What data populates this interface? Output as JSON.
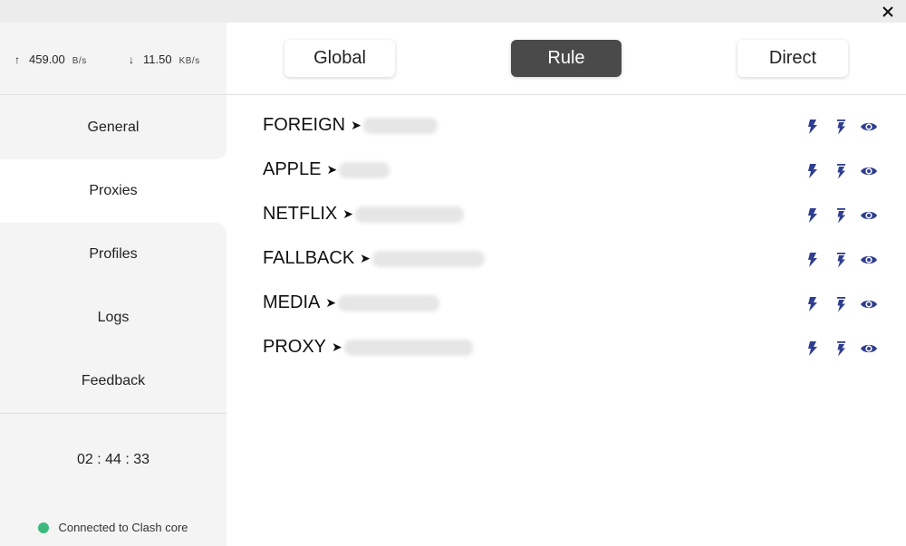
{
  "traffic": {
    "up_arrow": "↑",
    "up_value": "459.00",
    "up_unit": "B/s",
    "down_arrow": "↓",
    "down_value": "11.50",
    "down_unit": "KB/s"
  },
  "nav": {
    "items": [
      {
        "label": "General"
      },
      {
        "label": "Proxies"
      },
      {
        "label": "Profiles"
      },
      {
        "label": "Logs"
      },
      {
        "label": "Feedback"
      }
    ],
    "active": "Proxies"
  },
  "timer": "02 : 44 : 33",
  "status": {
    "text": "Connected to Clash core",
    "color": "#3cba7c"
  },
  "modes": {
    "items": [
      {
        "label": "Global"
      },
      {
        "label": "Rule"
      },
      {
        "label": "Direct"
      }
    ],
    "active": "Rule"
  },
  "groups": [
    {
      "name": "FOREIGN"
    },
    {
      "name": "APPLE"
    },
    {
      "name": "NETFLIX"
    },
    {
      "name": "FALLBACK"
    },
    {
      "name": "MEDIA"
    },
    {
      "name": "PROXY"
    }
  ],
  "icons": {
    "close": "close-icon",
    "speedtest": "lightning-bolt-icon",
    "speedtest_all": "lightning-bolt-list-icon",
    "view": "eye-icon"
  },
  "colors": {
    "accent": "#2f3e8f",
    "active_mode": "#4a4a4a",
    "sidebar_bg": "#f4f4f4"
  }
}
